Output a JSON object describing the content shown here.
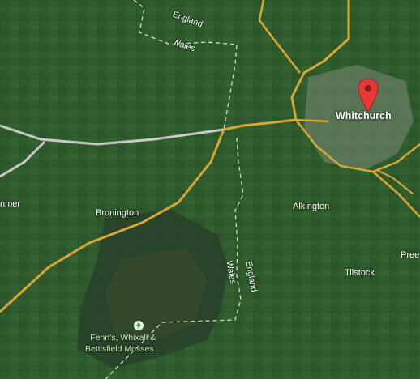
{
  "map": {
    "colors": {
      "grass": "#2f5a2e",
      "moss": "#2a4526",
      "road": "#d9a636",
      "motorway": "#c9c9c9",
      "border": "#e8e8e8",
      "town": "#7b8a79",
      "label": "#ffffff",
      "marker": "#e53935"
    },
    "places": {
      "whitchurch": "Whitchurch",
      "bronington": "Bronington",
      "alkington": "Alkington",
      "tilstock": "Tilstock",
      "preeses": "Pree",
      "hanmer": "nmer"
    },
    "borders": {
      "england_top": "England",
      "wales_top": "Wales",
      "wales_bottom": "Wales",
      "england_bottom": "England"
    },
    "park": {
      "line1": "Fenn's, Whixall &",
      "line2": "Bettisfield Mosses...",
      "icon": "tree-icon"
    },
    "marker": {
      "icon": "map-pin-icon"
    }
  }
}
